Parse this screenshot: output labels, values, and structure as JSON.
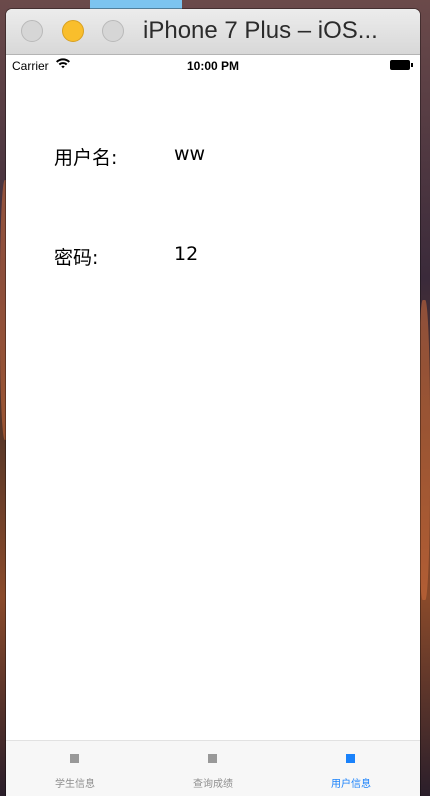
{
  "window": {
    "title": "iPhone 7 Plus – iOS..."
  },
  "status_bar": {
    "carrier": "Carrier",
    "time": "10:00 PM",
    "wifi_icon": "wifi-icon",
    "battery_icon": "battery-icon"
  },
  "user_info": {
    "username_label": "用户名:",
    "username_value": "ww",
    "password_label": "密码:",
    "password_value": "12"
  },
  "tab_bar": {
    "accent_color": "#1a82fb",
    "inactive_color": "#8e8e8e",
    "active_index": 2,
    "tabs": [
      {
        "label": "学生信息"
      },
      {
        "label": "查询成绩"
      },
      {
        "label": "用户信息"
      }
    ]
  }
}
